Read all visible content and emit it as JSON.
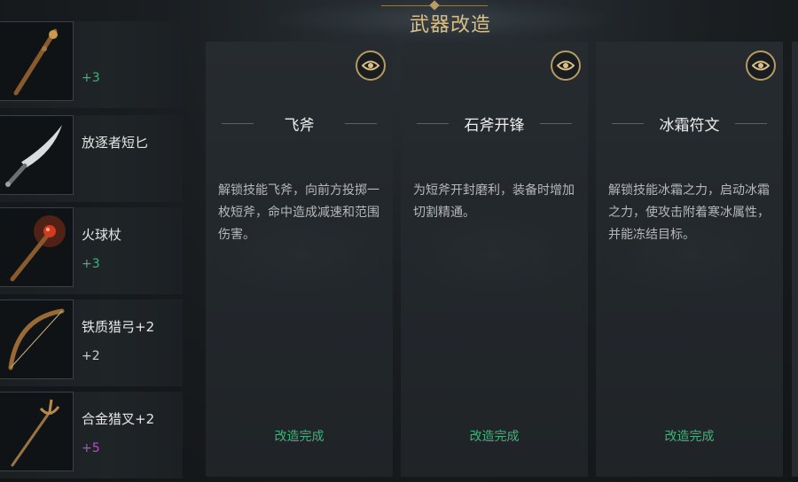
{
  "header": {
    "title": "武器改造"
  },
  "weapons": [
    {
      "name": "",
      "level": "+3",
      "level_color": "#3fb37a",
      "icon": "ornate-staff-icon"
    },
    {
      "name": "放逐者短匕",
      "level": "",
      "level_color": "#3fb37a",
      "icon": "curved-dagger-icon"
    },
    {
      "name": "火球杖",
      "level": "+3",
      "level_color": "#3fb37a",
      "icon": "fire-staff-icon"
    },
    {
      "name": "铁质猎弓+2",
      "level": "+2",
      "level_color": "#cfcfcf",
      "icon": "hunting-bow-icon"
    },
    {
      "name": "合金猎叉+2",
      "level": "+5",
      "level_color": "#c148d6",
      "icon": "trident-icon"
    }
  ],
  "cards": [
    {
      "title": "飞斧",
      "description": "解锁技能飞斧，向前方投掷一枚短斧，命中造成减速和范围伤害。",
      "status": "改造完成"
    },
    {
      "title": "石斧开锋",
      "description": "为短斧开封磨利，装备时增加切割精通。",
      "status": "改造完成"
    },
    {
      "title": "冰霜符文",
      "description": "解锁技能冰霜之力，启动冰霜之力，使攻击附着寒冰属性，并能冻结目标。",
      "status": "改造完成"
    }
  ],
  "colors": {
    "accent_gold": "#d8bf86",
    "status_green": "#3fb37a",
    "level_purple": "#c148d6"
  }
}
